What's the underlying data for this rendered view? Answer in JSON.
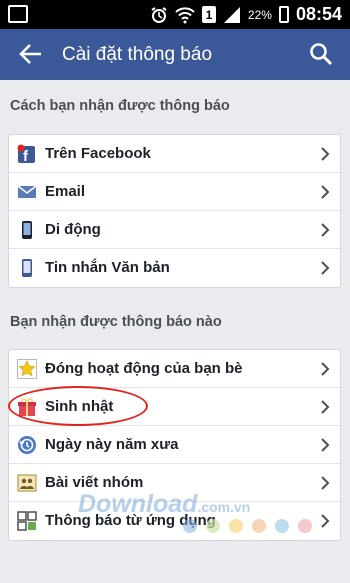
{
  "status_bar": {
    "sim_label": "1",
    "battery": "22%",
    "time": "08:54"
  },
  "header": {
    "title": "Cài đặt thông báo"
  },
  "sections": [
    {
      "title": "Cách bạn nhận được thông báo",
      "items": [
        {
          "label": "Trên Facebook",
          "icon": "facebook-notification-icon"
        },
        {
          "label": "Email",
          "icon": "email-icon"
        },
        {
          "label": "Di động",
          "icon": "mobile-phone-icon"
        },
        {
          "label": "Tin nhắn Văn bản",
          "icon": "sms-icon"
        }
      ]
    },
    {
      "title": "Bạn nhận được thông báo nào",
      "items": [
        {
          "label": "Đóng hoạt động của bạn bè",
          "icon": "star-icon"
        },
        {
          "label": "Sinh nhật",
          "icon": "gift-icon"
        },
        {
          "label": "Ngày này năm xưa",
          "icon": "memories-icon"
        },
        {
          "label": "Bài viết nhóm",
          "icon": "group-posts-icon"
        },
        {
          "label": "Thông báo từ ứng dụng",
          "icon": "app-notification-icon"
        }
      ]
    }
  ],
  "watermark": {
    "brand": "Download",
    "domain": ".com.vn",
    "dot_colors": [
      "#7fb3e0",
      "#cfe3a8",
      "#f6d06b",
      "#f6b88a",
      "#8fc4ea",
      "#f4a3a8"
    ]
  },
  "colors": {
    "header_bg": "#3b5998",
    "highlight": "#e0241c"
  }
}
